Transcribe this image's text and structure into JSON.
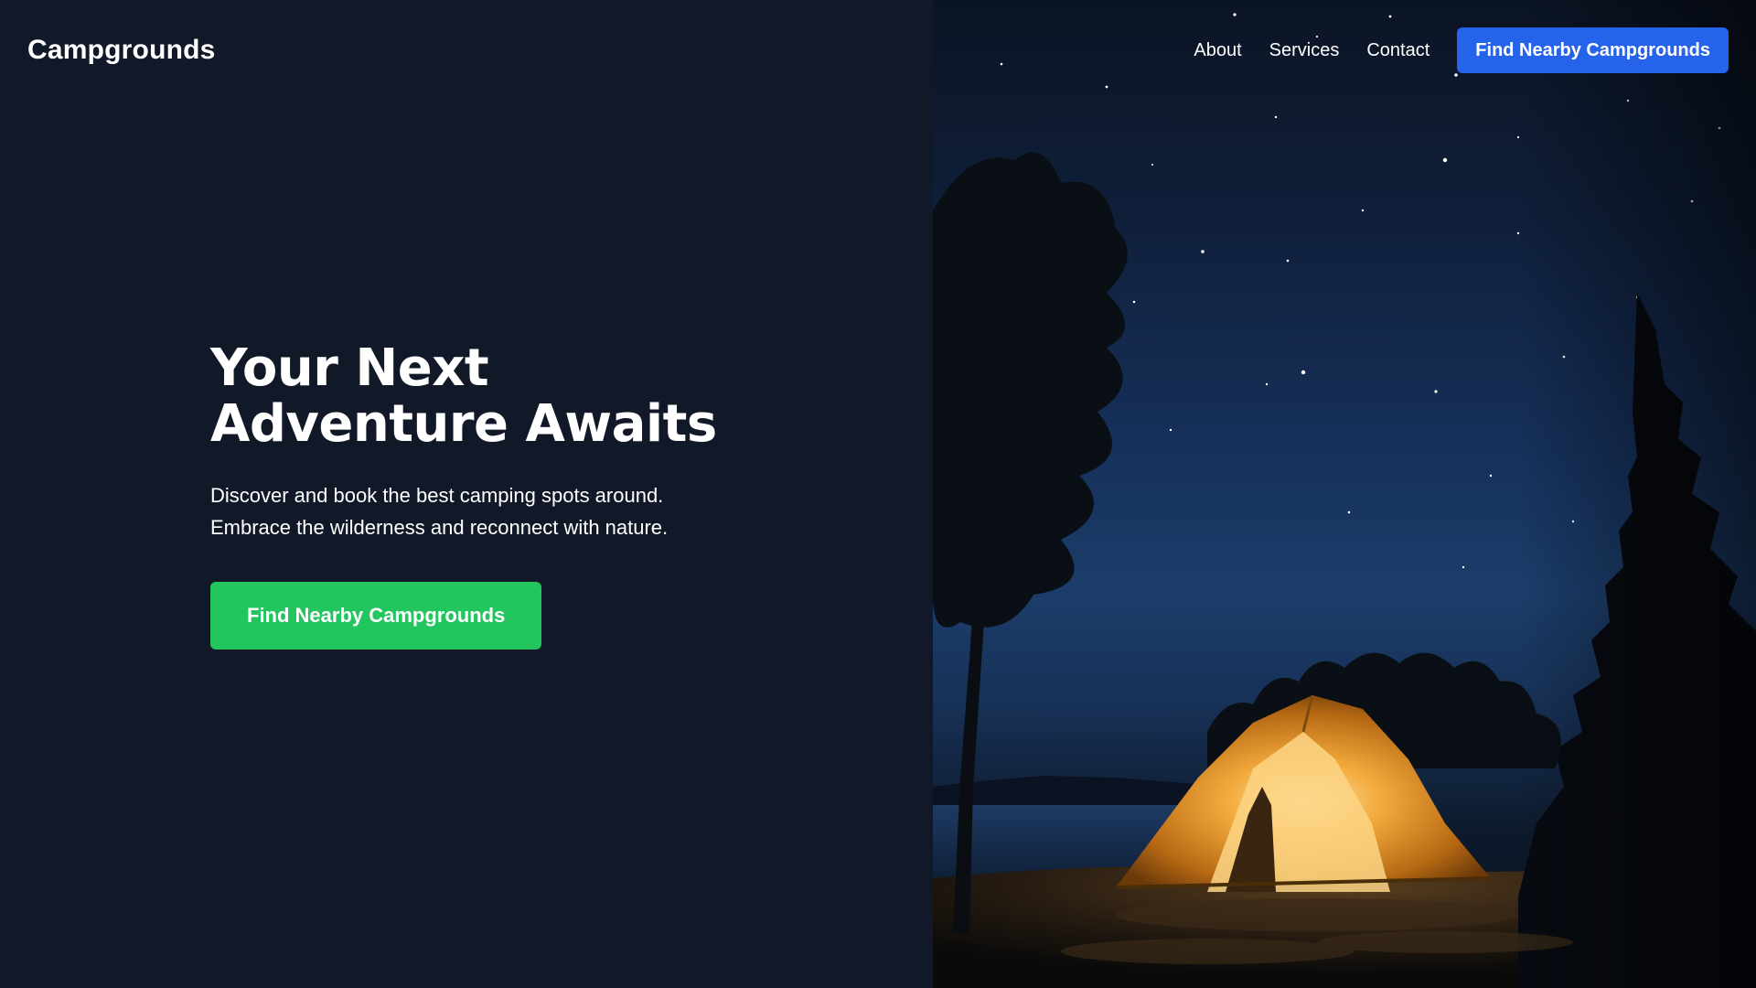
{
  "brand": {
    "name": "Campgrounds"
  },
  "nav": {
    "links": [
      "About",
      "Services",
      "Contact"
    ],
    "cta_label": "Find Nearby Campgrounds"
  },
  "hero": {
    "title_line1": "Your Next",
    "title_line2": "Adventure Awaits",
    "subtitle_line1": "Discover and book the best camping spots around.",
    "subtitle_line2": "Embrace the wilderness and reconnect with nature.",
    "cta_label": "Find Nearby Campgrounds"
  },
  "image": {
    "subject": "tent-under-starry-night-sky"
  },
  "colors": {
    "page_background": "#111827",
    "primary_blue": "#2563eb",
    "primary_green": "#22c55e",
    "text": "#ffffff"
  }
}
